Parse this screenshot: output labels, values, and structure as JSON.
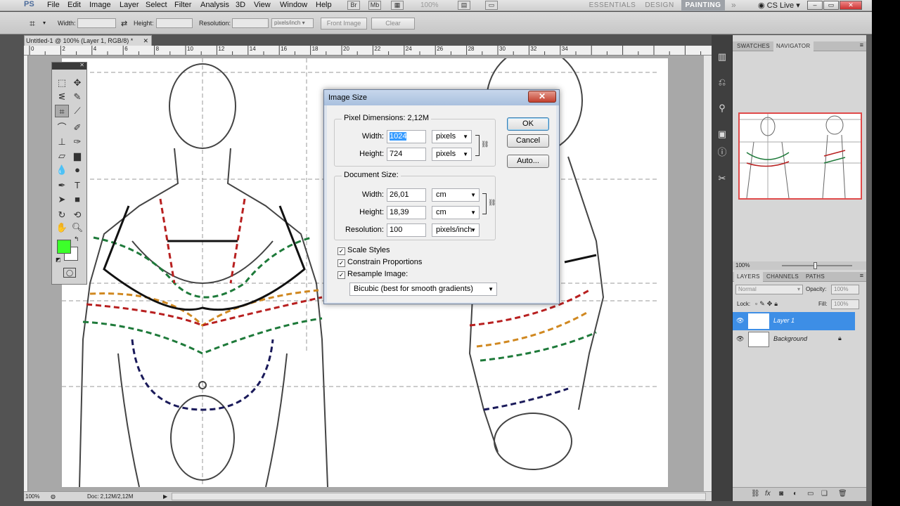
{
  "app": {
    "logo": "PS"
  },
  "menu": {
    "items": [
      "File",
      "Edit",
      "Image",
      "Layer",
      "Select",
      "Filter",
      "Analysis",
      "3D",
      "View",
      "Window",
      "Help"
    ]
  },
  "menubar": {
    "zoom": "100%",
    "workspaces": [
      "ESSENTIALS",
      "DESIGN",
      "PAINTING"
    ],
    "active_workspace": "PAINTING",
    "cs_live": "CS Live"
  },
  "options": {
    "width_label": "Width:",
    "height_label": "Height:",
    "resolution_label": "Resolution:",
    "units": "pixels/inch",
    "front_image": "Front Image",
    "clear": "Clear"
  },
  "document": {
    "tab_title": "Untitled-1 @ 100% (Layer 1, RGB/8) *",
    "zoom": "100%",
    "doc_size": "Doc: 2,12M/2,12M"
  },
  "ruler": {
    "ticks": [
      "0",
      "2",
      "4",
      "6",
      "8",
      "10",
      "12",
      "14",
      "16",
      "18",
      "20",
      "22",
      "24",
      "26",
      "28",
      "30",
      "32",
      "34"
    ]
  },
  "tools": {
    "foreground_color": "#3cff2a",
    "background_color": "#ffffff"
  },
  "dialog": {
    "title": "Image Size",
    "pixel_dimensions": {
      "title": "Pixel Dimensions:",
      "size": "2,12M",
      "width_label": "Width:",
      "width_value": "1024",
      "width_unit": "pixels",
      "height_label": "Height:",
      "height_value": "724",
      "height_unit": "pixels"
    },
    "document_size": {
      "title": "Document Size:",
      "width_label": "Width:",
      "width_value": "26,01",
      "width_unit": "cm",
      "height_label": "Height:",
      "height_value": "18,39",
      "height_unit": "cm",
      "resolution_label": "Resolution:",
      "resolution_value": "100",
      "resolution_unit": "pixels/inch"
    },
    "checkboxes": {
      "scale_styles": "Scale Styles",
      "constrain": "Constrain Proportions",
      "resample": "Resample Image:"
    },
    "resample_method": "Bicubic (best for smooth gradients)",
    "buttons": {
      "ok": "OK",
      "cancel": "Cancel",
      "auto": "Auto..."
    }
  },
  "navigator": {
    "tabs": [
      "SWATCHES",
      "NAVIGATOR"
    ],
    "active_tab": "NAVIGATOR",
    "zoom": "100%"
  },
  "layers": {
    "tabs": [
      "LAYERS",
      "CHANNELS",
      "PATHS"
    ],
    "blend_mode": "Normal",
    "opacity_label": "Opacity:",
    "opacity": "100%",
    "lock_label": "Lock:",
    "fill_label": "Fill:",
    "fill": "100%",
    "items": [
      {
        "name": "Layer 1"
      },
      {
        "name": "Background"
      }
    ]
  }
}
